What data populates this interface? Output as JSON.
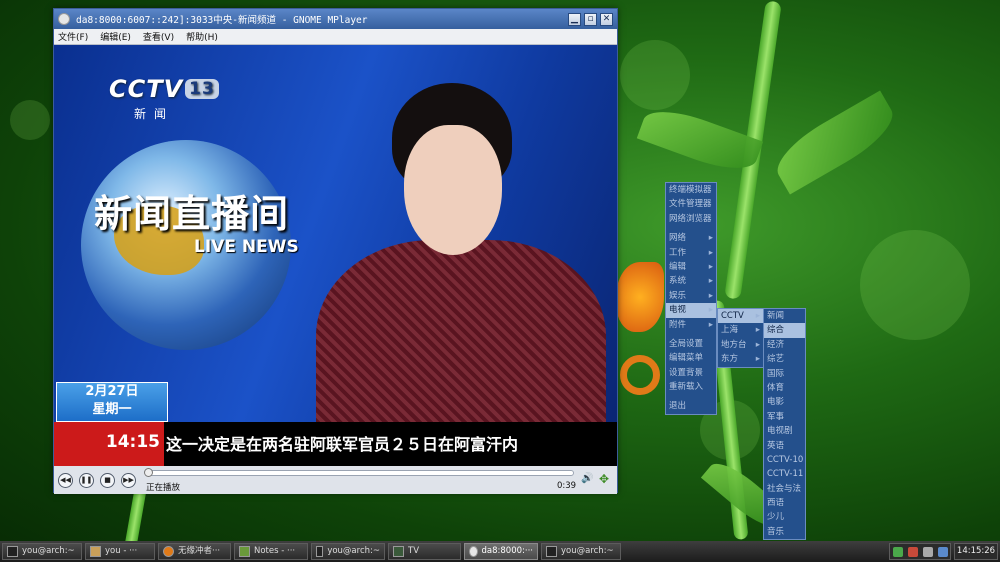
{
  "window": {
    "title": "da8:8000:6007::242]:3033中央-新闻频道 - GNOME MPlayer",
    "buttons": {
      "minimize": "▁",
      "maximize": "▫",
      "close": "✕"
    }
  },
  "menubar": [
    "文件(F)",
    "编辑(E)",
    "查看(V)",
    "帮助(H)"
  ],
  "video": {
    "channel_logo": "CCTV",
    "channel_number": "13",
    "channel_sub": "新闻",
    "program_title": "新闻直播间",
    "program_subtitle": "LIVE NEWS",
    "date": "2月27日",
    "weekday": "星期一",
    "ticker_time": "14:15",
    "ticker_text": "这一决定是在两名驻阿联军官员２５日在阿富汗内"
  },
  "controls": {
    "status": "正在播放",
    "time": "0:39",
    "progress": 0.0,
    "icons": [
      "rewind-icon",
      "pause-icon",
      "stop-icon",
      "fast-forward-icon",
      "volume-icon",
      "fullscreen-icon"
    ]
  },
  "menu_main": {
    "group1": [
      "终端模拟器",
      "文件管理器",
      "网络浏览器"
    ],
    "group2": [
      "网络",
      "工作",
      "编辑",
      "系统",
      "娱乐",
      "电视",
      "附件"
    ],
    "group3": [
      "全局设置",
      "编辑菜单",
      "设置背景",
      "重新载入"
    ],
    "group4": [
      "退出"
    ]
  },
  "menu_tv": [
    "CCTV",
    "上海",
    "地方台",
    "东方"
  ],
  "menu_cctv": [
    "新闻",
    "综合",
    "经济",
    "综艺",
    "国际",
    "体育",
    "电影",
    "军事",
    "电视剧",
    "英语",
    "CCTV-10",
    "CCTV-11",
    "社会与法",
    "西语",
    "少儿",
    "音乐"
  ],
  "taskbar": {
    "tasks": [
      "you@arch:~",
      "you - ···",
      "无缘冲者···",
      "Notes - ···",
      "you@arch:~",
      "TV",
      "da8:8000:···",
      "you@arch:~"
    ],
    "clock": "14:15:26"
  },
  "colors": {
    "menu_bg": "#24508c",
    "menu_highlight": "#aac1e0",
    "title_bar": "#355f9e",
    "ticker_red": "#cc1a1a"
  }
}
